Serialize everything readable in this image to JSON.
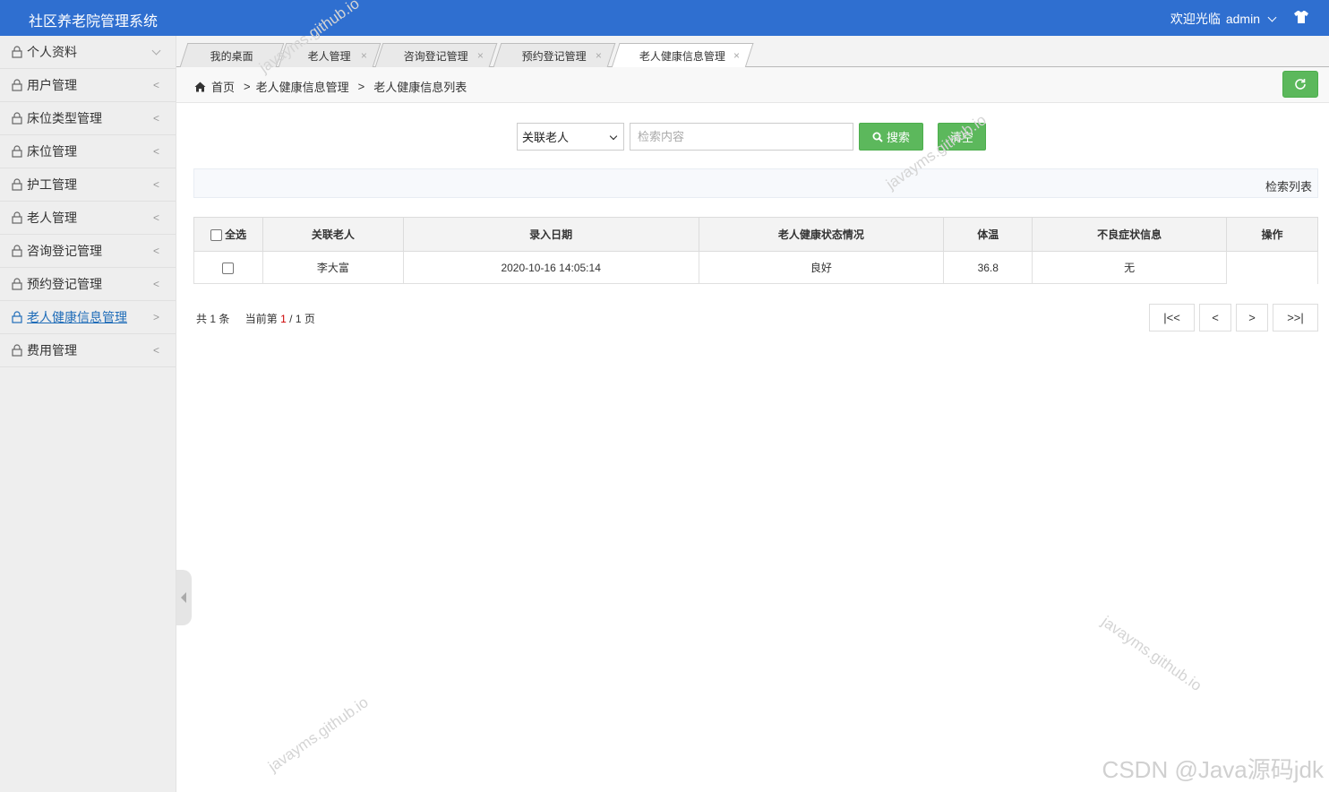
{
  "header": {
    "app_title": "社区养老院管理系统",
    "welcome": "欢迎光临",
    "username": "admin"
  },
  "sidebar": {
    "items": [
      {
        "label": "个人资料"
      },
      {
        "label": "用户管理"
      },
      {
        "label": "床位类型管理"
      },
      {
        "label": "床位管理"
      },
      {
        "label": "护工管理"
      },
      {
        "label": "老人管理"
      },
      {
        "label": "咨询登记管理"
      },
      {
        "label": "预约登记管理"
      },
      {
        "label": "老人健康信息管理"
      },
      {
        "label": "费用管理"
      }
    ],
    "arrow_collapsed": "<",
    "arrow_active": ">"
  },
  "tabs": [
    {
      "label": "我的桌面"
    },
    {
      "label": "老人管理"
    },
    {
      "label": "咨询登记管理"
    },
    {
      "label": "预约登记管理"
    },
    {
      "label": "老人健康信息管理"
    }
  ],
  "tab_close": "×",
  "breadcrumb": {
    "home": "首页",
    "sep": ">",
    "level1": "老人健康信息管理",
    "level2": "老人健康信息列表"
  },
  "search": {
    "select_value": "关联老人",
    "placeholder": "检索内容",
    "search_label": "搜索",
    "clear_label": "清空"
  },
  "list_banner": "检索列表",
  "table": {
    "columns": [
      "全选",
      "关联老人",
      "录入日期",
      "老人健康状态情况",
      "体温",
      "不良症状信息",
      "操作"
    ],
    "rows": [
      {
        "elder": "李大富",
        "date": "2020-10-16 14:05:14",
        "status": "良好",
        "temp": "36.8",
        "symptoms": "无",
        "ops": ""
      }
    ]
  },
  "pager": {
    "total_prefix": "共",
    "total": "1",
    "total_suffix": "条",
    "current_prefix": "当前第",
    "current": "1",
    "sep": "/",
    "pages": "1",
    "pages_suffix": "页",
    "first": "|<<",
    "prev": "<",
    "next": ">",
    "last": ">>|"
  },
  "watermark": "javayms.github.io",
  "credit": "CSDN @Java源码jdk"
}
